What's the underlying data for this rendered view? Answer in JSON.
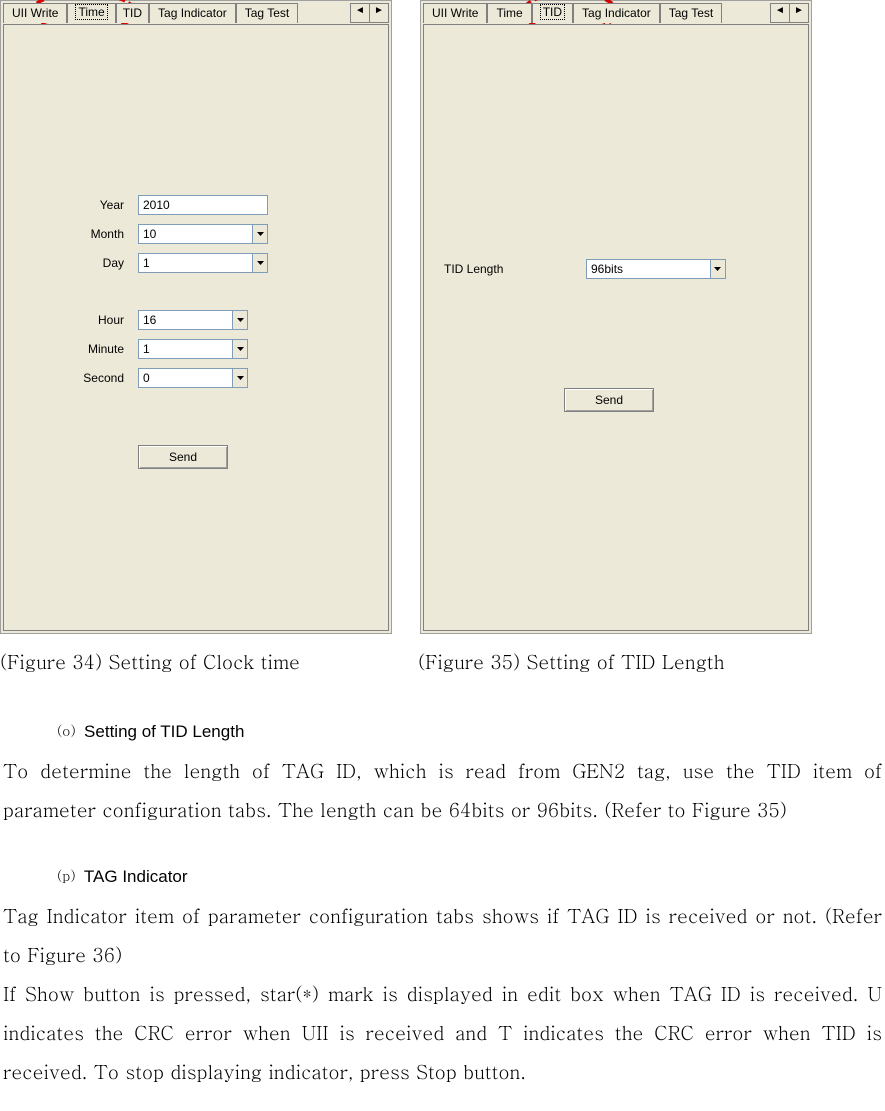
{
  "left_panel": {
    "tabs": [
      "UII Write",
      "Time",
      "TID",
      "Tag Indicator",
      "Tag Test"
    ],
    "selected_tab_index": 1,
    "fields": {
      "year_label": "Year",
      "year_value": "2010",
      "month_label": "Month",
      "month_value": "10",
      "day_label": "Day",
      "day_value": "1",
      "hour_label": "Hour",
      "hour_value": "16",
      "minute_label": "Minute",
      "minute_value": "1",
      "second_label": "Second",
      "second_value": "0"
    },
    "send_label": "Send"
  },
  "right_panel": {
    "tabs": [
      "UII Write",
      "Time",
      "TID",
      "Tag Indicator",
      "Tag Test"
    ],
    "selected_tab_index": 2,
    "tid_length_label": "TID Length",
    "tid_length_value": "96bits",
    "send_label": "Send"
  },
  "arrows": {
    "left": "◄",
    "right": "►"
  },
  "captions": {
    "left": "(Figure 34) Setting of Clock time",
    "right": "(Figure 35) Setting of TID Length"
  },
  "section_o": {
    "marker": "(o)",
    "title": "Setting of TID Length",
    "para": "To determine the length of TAG ID, which is read from GEN2 tag, use the TID item of parameter configuration tabs. The length can be 64bits or 96bits. (Refer to Figure 35)"
  },
  "section_p": {
    "marker": "(p)",
    "title": "TAG Indicator",
    "para1": "Tag Indicator item of parameter configuration tabs shows if TAG ID is received or not. (Refer to Figure 36)",
    "para2": "If Show button is pressed, star(*) mark is displayed in edit box when TAG ID is received. U indicates the CRC error when UII is received and T indicates the CRC error when TID is received. To stop displaying indicator, press Stop button."
  }
}
